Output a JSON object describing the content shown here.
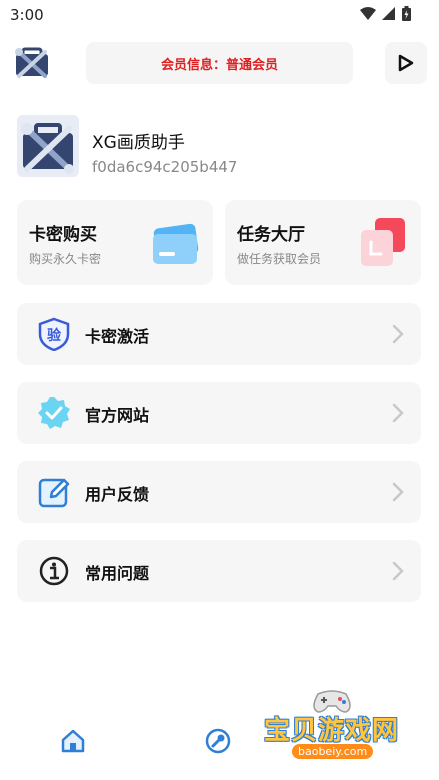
{
  "status_bar": {
    "time": "3:00"
  },
  "header": {
    "member_info": "会员信息：普通会员"
  },
  "profile": {
    "name": "XG画质助手",
    "device_id": "f0da6c94c205b447"
  },
  "cards": [
    {
      "title": "卡密购买",
      "subtitle": "购买永久卡密"
    },
    {
      "title": "任务大厅",
      "subtitle": "做任务获取会员"
    }
  ],
  "rows": [
    {
      "label": "卡密激活",
      "icon_char": "验"
    },
    {
      "label": "官方网站"
    },
    {
      "label": "用户反馈"
    },
    {
      "label": "常用问题"
    }
  ],
  "watermark": {
    "brand": "宝贝游戏网",
    "url": "baobeiy.com"
  },
  "colors": {
    "accent_blue": "#2f7fd6",
    "member_red": "#e02020",
    "card_bg": "#f6f6f6"
  }
}
